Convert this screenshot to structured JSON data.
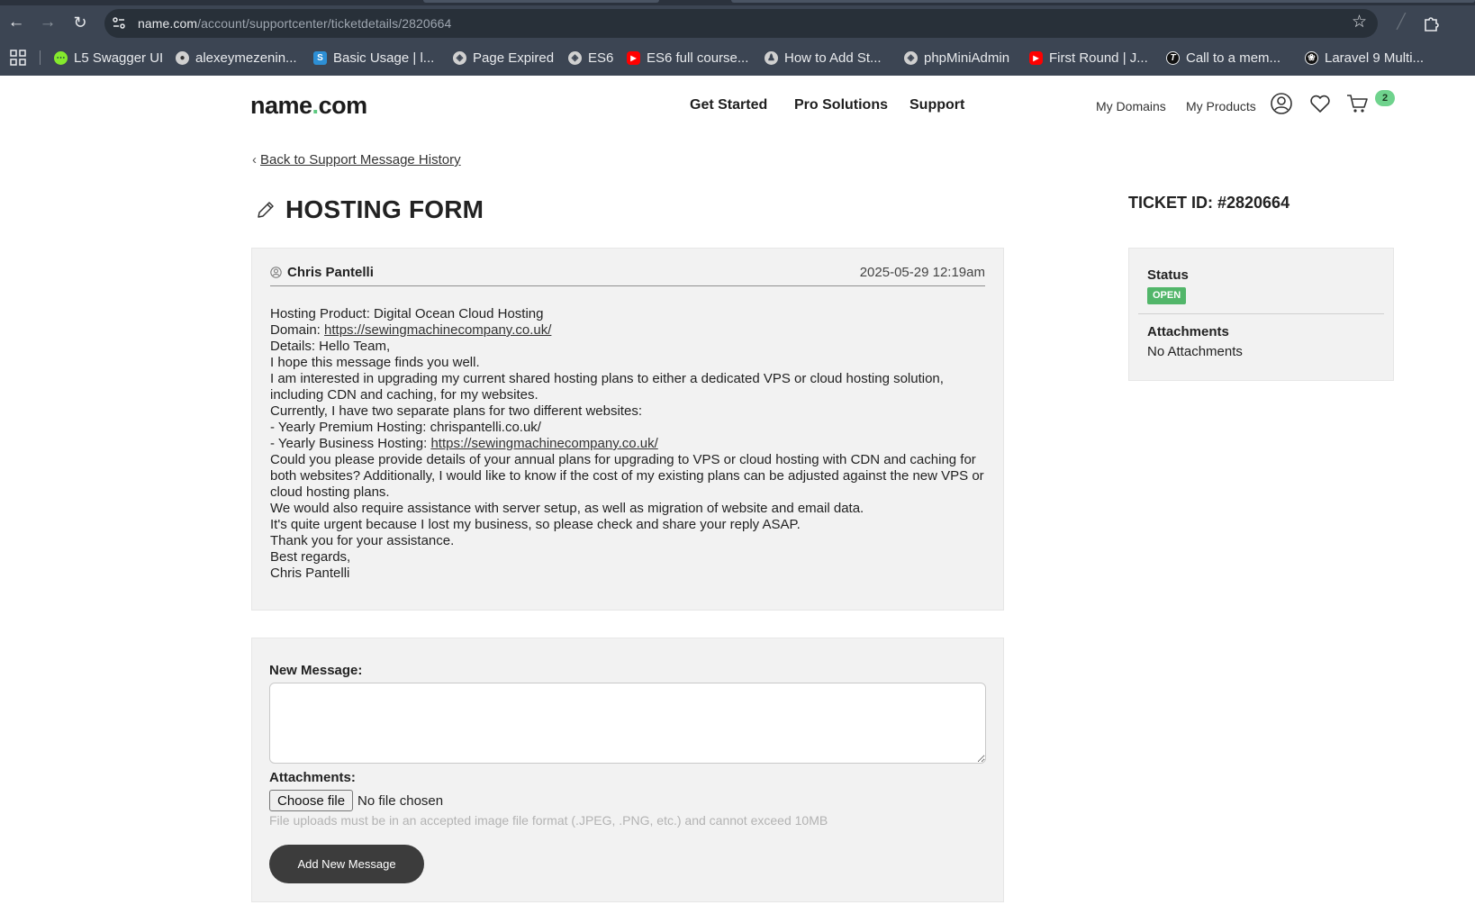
{
  "browser": {
    "url_host": "name.com",
    "url_path": "/account/supportcenter/ticketdetails/2820664",
    "bookmarks": [
      {
        "label": "L5 Swagger UI",
        "icon": "swagger-icon",
        "color": "#85ea2d"
      },
      {
        "label": "alexeymezenin...",
        "icon": "github-icon",
        "color": "#d0d0d0"
      },
      {
        "label": "Basic Usage | l...",
        "icon": "s-icon",
        "color": "#2d8fd5"
      },
      {
        "label": "Page Expired",
        "icon": "globe-icon",
        "color": "#d0d0d0"
      },
      {
        "label": "ES6",
        "icon": "globe-icon",
        "color": "#d0d0d0"
      },
      {
        "label": "ES6 full course...",
        "icon": "youtube-icon",
        "color": "#ff0000"
      },
      {
        "label": "How to Add St...",
        "icon": "people-icon",
        "color": "#d0d0d0"
      },
      {
        "label": "phpMiniAdmin",
        "icon": "globe-icon",
        "color": "#d0d0d0"
      },
      {
        "label": "First Round | J...",
        "icon": "youtube-icon",
        "color": "#ff0000"
      },
      {
        "label": "Call to a mem...",
        "icon": "t-icon",
        "color": "#111111"
      },
      {
        "label": "Laravel 9 Multi...",
        "icon": "openai-icon",
        "color": "#111111"
      }
    ]
  },
  "site": {
    "logo_main": "name",
    "logo_dot": ".",
    "logo_tld": "com",
    "nav": [
      "Get Started",
      "Pro Solutions",
      "Support"
    ],
    "user_nav": [
      "My Domains",
      "My Products"
    ],
    "cart_count": "2",
    "accent_color": "#5cc87f"
  },
  "page": {
    "back_link": "Back to Support Message History",
    "title": "HOSTING FORM"
  },
  "message": {
    "author": "Chris Pantelli",
    "date": "2025-05-29 12:19am",
    "lines": [
      {
        "text": "Hosting Product: Digital Ocean Cloud Hosting"
      },
      {
        "text": "Domain: ",
        "link": "https://sewingmachinecompany.co.uk/"
      },
      {
        "text": "Details: Hello Team,"
      },
      {
        "text": "I hope this message finds you well."
      },
      {
        "text": "I am interested in upgrading my current shared hosting plans to either a dedicated VPS or cloud hosting solution, including CDN and caching, for my websites."
      },
      {
        "text": "Currently, I have two separate plans for two different websites:"
      },
      {
        "text": "- Yearly Premium Hosting: chrispantelli.co.uk/"
      },
      {
        "text": "- Yearly Business Hosting: ",
        "link": "https://sewingmachinecompany.co.uk/"
      },
      {
        "text": "Could you please provide details of your annual plans for upgrading to VPS or cloud hosting with CDN and caching for both websites? Additionally, I would like to know if the cost of my existing plans can be adjusted against the new VPS or cloud hosting plans."
      },
      {
        "text": "We would also require assistance with server setup, as well as migration of website and email data."
      },
      {
        "text": "It's quite urgent because I lost my business, so please check and share your reply ASAP."
      },
      {
        "text": "Thank you for your assistance."
      },
      {
        "text": "Best regards,"
      },
      {
        "text": "Chris Pantelli"
      }
    ]
  },
  "form": {
    "new_message_label": "New Message:",
    "new_message_value": "",
    "attachments_label": "Attachments:",
    "choose_file_label": "Choose file",
    "no_file_text": "No file chosen",
    "hint": "File uploads must be in an accepted image file format (.JPEG, .PNG, etc.) and cannot exceed 10MB",
    "submit_label": "Add New Message"
  },
  "sidebar": {
    "ticket_id": "TICKET ID: #2820664",
    "status_label": "Status",
    "status_value": "OPEN",
    "status_color": "#52b66a",
    "attachments_label": "Attachments",
    "attachments_value": "No Attachments"
  }
}
